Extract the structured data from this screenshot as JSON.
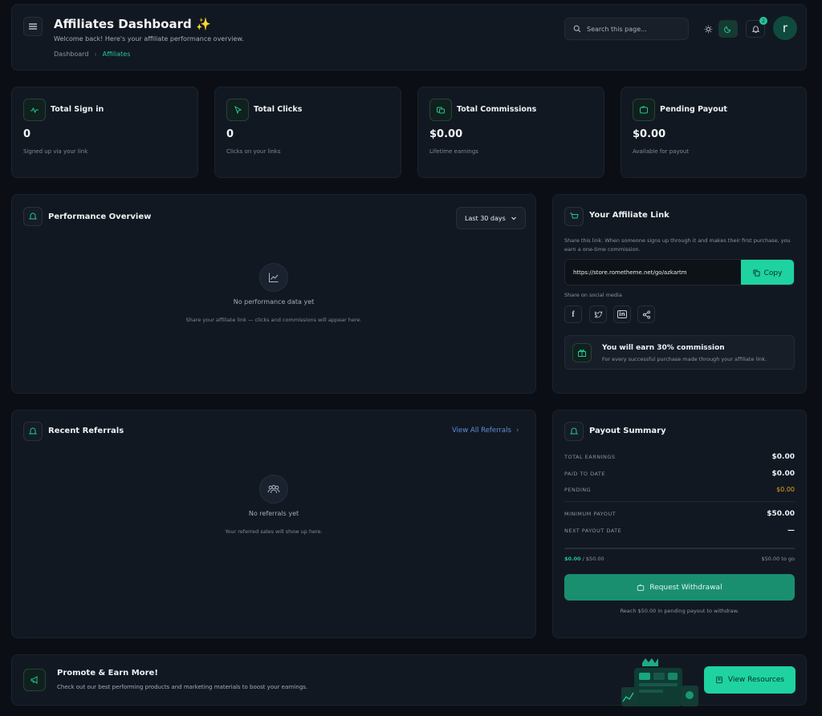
{
  "header": {
    "title": "Affiliates Dashboard ✨",
    "subtitle": "Welcome back! Here's your affiliate performance overview.",
    "breadcrumb": [
      "Dashboard",
      "Affiliates"
    ],
    "search_placeholder": "Search this page...",
    "notification_count": "2",
    "avatar_initial": "r"
  },
  "stats": [
    {
      "title": "Total Sign in",
      "value": "0",
      "sub": "Signed up via your link"
    },
    {
      "title": "Total Clicks",
      "value": "0",
      "sub": "Clicks on your links"
    },
    {
      "title": "Total Commissions",
      "value": "$0.00",
      "sub": "Lifetime earnings"
    },
    {
      "title": "Pending Payout",
      "value": "$0.00",
      "sub": "Available for payout"
    }
  ],
  "performance": {
    "title": "Performance Overview",
    "range": "Last 30 days",
    "empty_title": "No performance data yet",
    "empty_sub": "Share your affiliate link — clicks and commissions will appear here."
  },
  "affiliate_link": {
    "title": "Your Affiliate Link",
    "description": "Share this link. When someone signs up through it and makes their first purchase, you earn a one-time commission.",
    "url": "https://store.rometheme.net/go/azkartm",
    "copy_label": "Copy",
    "share_label": "Share on social media",
    "commission_title": "You will earn 30% commission",
    "commission_sub": "For every successful purchase made through your affiliate link."
  },
  "referrals": {
    "title": "Recent Referrals",
    "view_all": "View All Referrals",
    "empty_title": "No referrals yet",
    "empty_sub": "Your referred sales will show up here."
  },
  "payout": {
    "title": "Payout Summary",
    "rows": [
      {
        "label": "TOTAL EARNINGS",
        "value": "$0.00"
      },
      {
        "label": "PAID TO DATE",
        "value": "$0.00"
      },
      {
        "label": "PENDING",
        "value": "$0.00"
      },
      {
        "label": "MINIMUM PAYOUT",
        "value": "$50.00"
      },
      {
        "label": "NEXT PAYOUT DATE",
        "value": "—"
      }
    ],
    "progress_current": "$0.00",
    "progress_target": "/ $50.00",
    "progress_remaining": "$50.00 to go",
    "progress_fraction": 0,
    "withdraw_label": "Request Withdrawal",
    "withdraw_note": "Reach $50.00 in pending payout to withdraw."
  },
  "promo": {
    "title": "Promote & Earn More!",
    "sub": "Check out our best performing products and marketing materials to boost your earnings.",
    "button": "View Resources"
  },
  "colors": {
    "accent": "#1ed3a0",
    "pending": "#e0a526",
    "background": "#0b0f15"
  }
}
